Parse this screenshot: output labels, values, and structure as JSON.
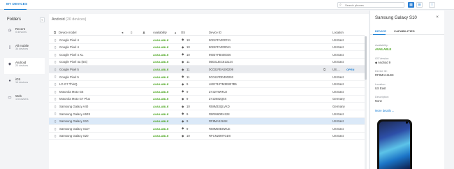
{
  "topbar": {
    "brand": "MY DEVICES",
    "search_placeholder": "Search phones",
    "search_icon": "search-icon",
    "grid_icon": "grid-view-icon",
    "list_icon": "list-view-icon",
    "info_icon": "info-icon",
    "info_glyph": "i",
    "accent": "#1a7fd4"
  },
  "folders": {
    "title": "Folders",
    "collapse_glyph": "«",
    "items": [
      {
        "name": "Recent",
        "count": "0 devices",
        "icon": "clock-icon"
      },
      {
        "name": "All mobile",
        "count": "34 devices",
        "icon": "mobile-icon"
      },
      {
        "name": "Android",
        "count": "20 devices",
        "icon": "android-icon"
      },
      {
        "name": "iOS",
        "count": "14 devices",
        "icon": "apple-icon"
      },
      {
        "name": "Web",
        "count": "1 browsers",
        "icon": "monitor-icon"
      }
    ]
  },
  "main": {
    "title": "Android",
    "count": "(20 devices)",
    "columns": {
      "model": "Device model",
      "availability": "Availability",
      "os": "OS",
      "device_id": "Device ID",
      "location": "Location"
    },
    "rows": [
      {
        "name": "Google Pixel 4",
        "availability": "AVAILABLE",
        "os_version": "10",
        "device_id": "9021FFAZ00741",
        "location": "US East"
      },
      {
        "name": "Google Pixel 4",
        "availability": "AVAILABLE",
        "os_version": "10",
        "device_id": "9024FFAZ00041",
        "location": "US East"
      },
      {
        "name": "Google Pixel 4 XL",
        "availability": "AVAILABLE",
        "os_version": "10",
        "device_id": "9903YFB400026",
        "location": "US East"
      },
      {
        "name": "Google Pixel 4a (5G)",
        "availability": "AVAILABLE",
        "os_version": "11",
        "device_id": "0B031JEC813124",
        "location": "US East"
      },
      {
        "name": "Google Pixel 5",
        "availability": "AVAILABLE",
        "os_version": "11",
        "device_id": "0C031FEAS00209",
        "location": "US ...",
        "open": "OPEN"
      },
      {
        "name": "Google Pixel 5",
        "availability": "AVAILABLE",
        "os_version": "11",
        "device_id": "0C041FDD400293",
        "location": "US East"
      },
      {
        "name": "LG G7 ThinQ",
        "availability": "AVAILABLE",
        "os_version": "9",
        "device_id": "LMG710TM3E8E7B5",
        "location": "US East"
      },
      {
        "name": "Motorola Moto G6",
        "availability": "AVAILABLE",
        "os_version": "9",
        "device_id": "ZY3279WRJJ",
        "location": "US East"
      },
      {
        "name": "Motorola Moto G7 Plus",
        "availability": "AVAILABLE",
        "os_version": "9",
        "device_id": "ZY22682Q5X",
        "location": "Germany"
      },
      {
        "name": "Samsung Galaxy A40",
        "availability": "AVAILABLE",
        "os_version": "10",
        "device_id": "R58M33QLVKD",
        "location": "Germany"
      },
      {
        "name": "Samsung Galaxy A50S",
        "availability": "AVAILABLE",
        "os_version": "9",
        "device_id": "R9RM60RH128",
        "location": "US East"
      },
      {
        "name": "Samsung Galaxy S10",
        "availability": "AVAILABLE",
        "os_version": "9",
        "device_id": "RF8MA12LBK",
        "location": "US East"
      },
      {
        "name": "Samsung Galaxy S10+",
        "availability": "AVAILABLE",
        "os_version": "9",
        "device_id": "R58M50BSWLE",
        "location": "US East"
      },
      {
        "name": "Samsung Galaxy S20",
        "availability": "AVAILABLE",
        "os_version": "10",
        "device_id": "RFCN20MTGDX",
        "location": "US East"
      }
    ]
  },
  "panel": {
    "title": "Samsung Galaxy S10",
    "close_glyph": "×",
    "tabs": [
      "DEVICE",
      "CAPABILITIES"
    ],
    "fields": [
      {
        "label": "Availability:",
        "value": "AVAILABLE"
      },
      {
        "label": "OS Version:",
        "value": "Android 9"
      },
      {
        "label": "Device ID:",
        "value": "RF8MA12LBK"
      },
      {
        "label": "Location:",
        "value": "US East"
      },
      {
        "label": "Description:",
        "value": "None"
      }
    ],
    "more": "More details ⌄"
  }
}
